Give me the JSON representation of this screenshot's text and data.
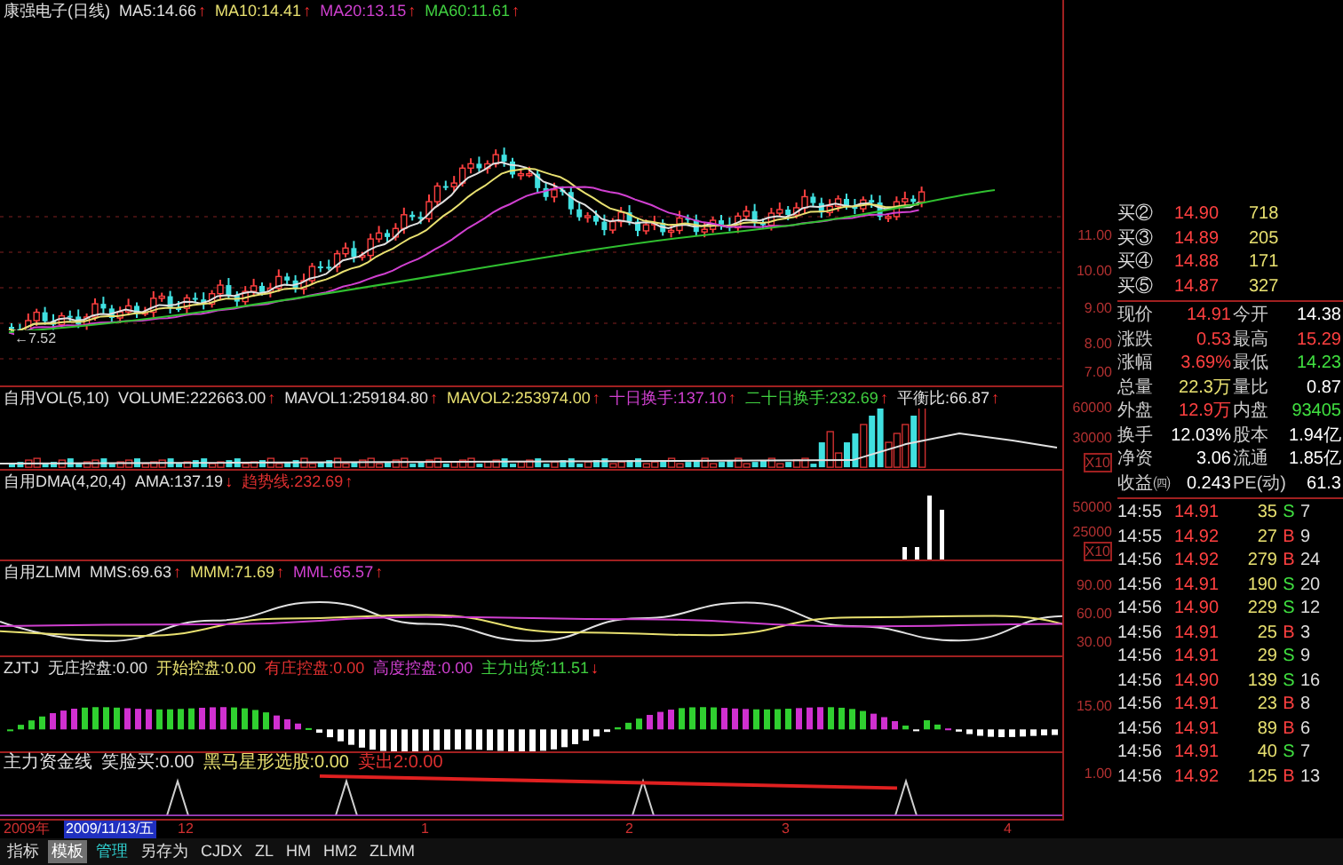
{
  "price_panel": {
    "legend": [
      {
        "text": "康强电子(日线)",
        "color": "#e0e0e0"
      },
      {
        "text": "MA5:14.66",
        "arrow": "↑",
        "color": "#e0e0e0"
      },
      {
        "text": "MA10:14.41",
        "arrow": "↑",
        "color": "#e8e070"
      },
      {
        "text": "MA20:13.15",
        "arrow": "↑",
        "color": "#d040d0"
      },
      {
        "text": "MA60:11.61",
        "arrow": "↑",
        "color": "#40d040"
      }
    ],
    "low_label": "←7.52"
  },
  "indicator_panels": [
    {
      "kind": "vol",
      "legend": [
        {
          "text": "自用VOL(5,10)",
          "color": "#e0e0e0"
        },
        {
          "text": "VOLUME:222663.00",
          "arrow": "↑",
          "color": "#e0e0e0"
        },
        {
          "text": "MAVOL1:259184.80",
          "arrow": "↑",
          "color": "#e0e0e0"
        },
        {
          "text": "MAVOL2:253974.00",
          "arrow": "↑",
          "color": "#e8e070"
        },
        {
          "text": "十日换手:137.10",
          "arrow": "↑",
          "color": "#d040d0"
        },
        {
          "text": "二十日换手:232.69",
          "arrow": "↑",
          "color": "#40d040"
        },
        {
          "text": "平衡比:66.87",
          "arrow": "↑",
          "color": "#e0e0e0"
        }
      ]
    },
    {
      "kind": "dma",
      "legend": [
        {
          "text": "自用DMA(4,20,4)",
          "color": "#e0e0e0"
        },
        {
          "text": "AMA:137.19",
          "arrow": "↓",
          "color": "#e0e0e0"
        },
        {
          "text": "趋势线:232.69",
          "arrow": "↑",
          "color": "#e03030"
        }
      ]
    },
    {
      "kind": "zlmm",
      "legend": [
        {
          "text": "自用ZLMM",
          "color": "#e0e0e0"
        },
        {
          "text": "MMS:69.63",
          "arrow": "↑",
          "color": "#e0e0e0"
        },
        {
          "text": "MMM:71.69",
          "arrow": "↑",
          "color": "#e8e070"
        },
        {
          "text": "MML:65.57",
          "arrow": "↑",
          "color": "#d040d0"
        }
      ]
    },
    {
      "kind": "zjtj",
      "legend": [
        {
          "text": "ZJTJ",
          "color": "#e0e0e0"
        },
        {
          "text": "无庄控盘:0.00",
          "color": "#e0e0e0"
        },
        {
          "text": "开始控盘:0.00",
          "color": "#e8e070"
        },
        {
          "text": "有庄控盘:0.00",
          "color": "#e03030"
        },
        {
          "text": "高度控盘:0.00",
          "color": "#d040d0"
        },
        {
          "text": "主力出货:11.51",
          "arrow": "↓",
          "color": "#40d040"
        }
      ]
    },
    {
      "kind": "signal",
      "legend": [
        {
          "text": "主力资金线",
          "color": "#e0e0e0"
        },
        {
          "text": "笑脸买:0.00",
          "color": "#e0e0e0"
        },
        {
          "text": "黑马星形选股:0.00",
          "color": "#e8e070"
        },
        {
          "text": "卖出2:0.00",
          "color": "#e03030"
        }
      ]
    }
  ],
  "axis_labels": [
    "11.00",
    "10.00",
    "9.00",
    "8.00",
    "7.00",
    "60000",
    "30000",
    "X10",
    "50000",
    "25000",
    "X10",
    "90.00",
    "60.00",
    "30.00",
    "15.00",
    "1.00"
  ],
  "date_axis": {
    "year": "2009年",
    "date": "2009/11/13/五",
    "months": [
      "12",
      "1",
      "2",
      "3",
      "4"
    ]
  },
  "bottom_tabs": [
    {
      "label": "指标",
      "selected": false
    },
    {
      "label": "模板",
      "selected": true
    },
    {
      "label": "管理",
      "selected": false,
      "color": "#30d0d0"
    },
    {
      "label": "另存为",
      "selected": false
    },
    {
      "label": "CJDX",
      "selected": false
    },
    {
      "label": "ZL",
      "selected": false
    },
    {
      "label": "HM",
      "selected": false
    },
    {
      "label": "HM2",
      "selected": false
    },
    {
      "label": "ZLMM",
      "selected": false
    }
  ],
  "bids": [
    {
      "label": "买②",
      "price": "14.90",
      "volume": "718"
    },
    {
      "label": "买③",
      "price": "14.89",
      "volume": "205"
    },
    {
      "label": "买④",
      "price": "14.88",
      "volume": "171"
    },
    {
      "label": "买⑤",
      "price": "14.87",
      "volume": "327"
    }
  ],
  "quote": [
    {
      "label": "现价",
      "value": "14.91",
      "color": "#ff4040"
    },
    {
      "label": "今开",
      "value": "14.38",
      "color": "#ffffff"
    },
    {
      "label": "涨跌",
      "value": "0.53",
      "color": "#ff4040"
    },
    {
      "label": "最高",
      "value": "15.29",
      "color": "#ff4040"
    },
    {
      "label": "涨幅",
      "value": "3.69%",
      "color": "#ff4040"
    },
    {
      "label": "最低",
      "value": "14.23",
      "color": "#40e040"
    },
    {
      "label": "总量",
      "value": "22.3万",
      "color": "#e8e070"
    },
    {
      "label": "量比",
      "value": "0.87",
      "color": "#ffffff"
    },
    {
      "label": "外盘",
      "value": "12.9万",
      "color": "#ff4040"
    },
    {
      "label": "内盘",
      "value": "93405",
      "color": "#40e040"
    },
    {
      "label": "换手",
      "value": "12.03%",
      "color": "#ffffff"
    },
    {
      "label": "股本",
      "value": "1.94亿",
      "color": "#ffffff"
    },
    {
      "label": "净资",
      "value": "3.06",
      "color": "#ffffff"
    },
    {
      "label": "流通",
      "value": "1.85亿",
      "color": "#ffffff"
    },
    {
      "label": "收益㈣",
      "value": "0.243",
      "color": "#ffffff"
    },
    {
      "label": "PE(动)",
      "value": "61.3",
      "color": "#ffffff"
    }
  ],
  "trades": [
    {
      "time": "14:55",
      "price": "14.91",
      "volume": "35",
      "side": "S",
      "color": "#40e040",
      "count": "7"
    },
    {
      "time": "14:55",
      "price": "14.92",
      "volume": "27",
      "side": "B",
      "color": "#ff4040",
      "count": "9"
    },
    {
      "time": "14:56",
      "price": "14.92",
      "volume": "279",
      "side": "B",
      "color": "#ff4040",
      "count": "24"
    },
    {
      "time": "14:56",
      "price": "14.91",
      "volume": "190",
      "side": "S",
      "color": "#40e040",
      "count": "20"
    },
    {
      "time": "14:56",
      "price": "14.90",
      "volume": "229",
      "side": "S",
      "color": "#40e040",
      "count": "12"
    },
    {
      "time": "14:56",
      "price": "14.91",
      "volume": "25",
      "side": "B",
      "color": "#ff4040",
      "count": "3"
    },
    {
      "time": "14:56",
      "price": "14.91",
      "volume": "29",
      "side": "S",
      "color": "#40e040",
      "count": "9"
    },
    {
      "time": "14:56",
      "price": "14.90",
      "volume": "139",
      "side": "S",
      "color": "#40e040",
      "count": "16"
    },
    {
      "time": "14:56",
      "price": "14.91",
      "volume": "23",
      "side": "B",
      "color": "#ff4040",
      "count": "8"
    },
    {
      "time": "14:56",
      "price": "14.91",
      "volume": "89",
      "side": "B",
      "color": "#ff4040",
      "count": "6"
    },
    {
      "time": "14:56",
      "price": "14.91",
      "volume": "40",
      "side": "S",
      "color": "#40e040",
      "count": "7"
    },
    {
      "time": "14:56",
      "price": "14.92",
      "volume": "125",
      "side": "B",
      "color": "#ff4040",
      "count": "13"
    }
  ]
}
